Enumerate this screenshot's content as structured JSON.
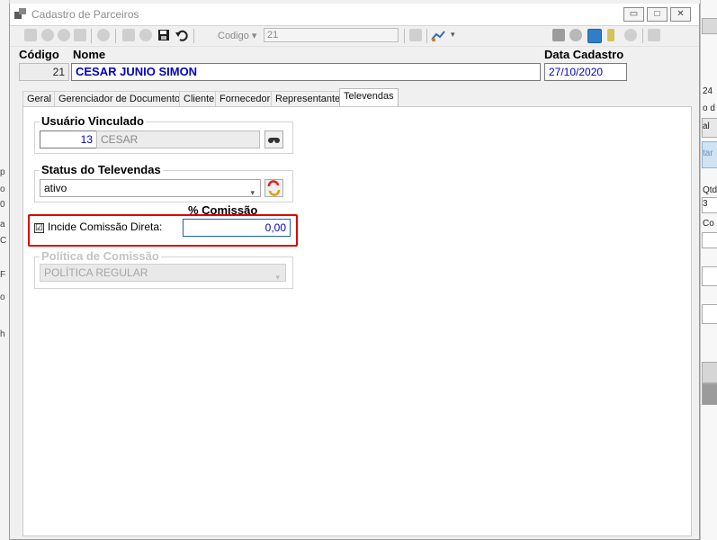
{
  "window": {
    "title": "Cadastro de Parceiros"
  },
  "toolbar": {
    "codigo_label": "Codigo",
    "codigo_value": "21",
    "icons": [
      "first-icon",
      "prev-icon",
      "next-icon",
      "last-icon",
      "add-icon",
      "edit-icon",
      "delete-icon",
      "save-icon",
      "undo-icon",
      "grid-icon",
      "chart-icon"
    ]
  },
  "header": {
    "codigo_label": "Código",
    "nome_label": "Nome",
    "data_label": "Data Cadastro",
    "codigo_value": "21",
    "nome_value": "CESAR JUNIO SIMON",
    "data_value": "27/10/2020"
  },
  "tabs": [
    "Geral",
    "Gerenciador de Documentos",
    "Cliente",
    "Fornecedor",
    "Representante",
    "Televendas"
  ],
  "active_tab": "Televendas",
  "televendas": {
    "usuario_title": "Usuário Vinculado",
    "usuario_code": "13",
    "usuario_name": "CESAR",
    "status_title": "Status do Televendas",
    "status_value": "ativo",
    "comissao_title": "% Comissão",
    "incide_label": "Incide Comissão Direta:",
    "incide_checked": "☑",
    "comissao_value": "0,00",
    "politica_title": "Política de Comissão",
    "politica_value": "POLÍTICA REGULAR"
  },
  "background": {
    "right_frags": [
      "24",
      "o d",
      "al",
      "tar",
      "Qtd",
      "3",
      "Co"
    ],
    "left_frags": [
      "p",
      "o",
      "0",
      "a",
      "C",
      "F",
      "o",
      "h"
    ]
  },
  "colors": {
    "highlight": "#e00000",
    "blue_text": "#0000c8",
    "accent": "#1c63b7"
  }
}
